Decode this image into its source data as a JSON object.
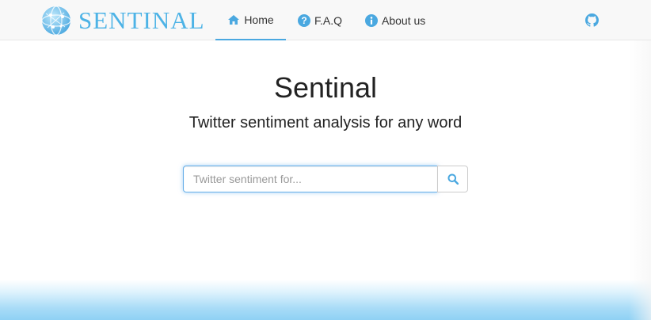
{
  "brand": {
    "name": "SENTINAL",
    "icon": "globe-network-icon",
    "color": "#4db3e6"
  },
  "nav": {
    "items": [
      {
        "label": "Home",
        "icon": "home-icon",
        "active": true
      },
      {
        "label": "F.A.Q",
        "icon": "question-circle-icon",
        "active": false
      },
      {
        "label": "About us",
        "icon": "info-circle-icon",
        "active": false
      }
    ],
    "github_icon": "github-icon",
    "accent_color": "#4aa8e0"
  },
  "hero": {
    "title": "Sentinal",
    "subtitle": "Twitter sentiment analysis for any word"
  },
  "search": {
    "placeholder": "Twitter sentiment for...",
    "value": "",
    "button_icon": "search-icon"
  }
}
